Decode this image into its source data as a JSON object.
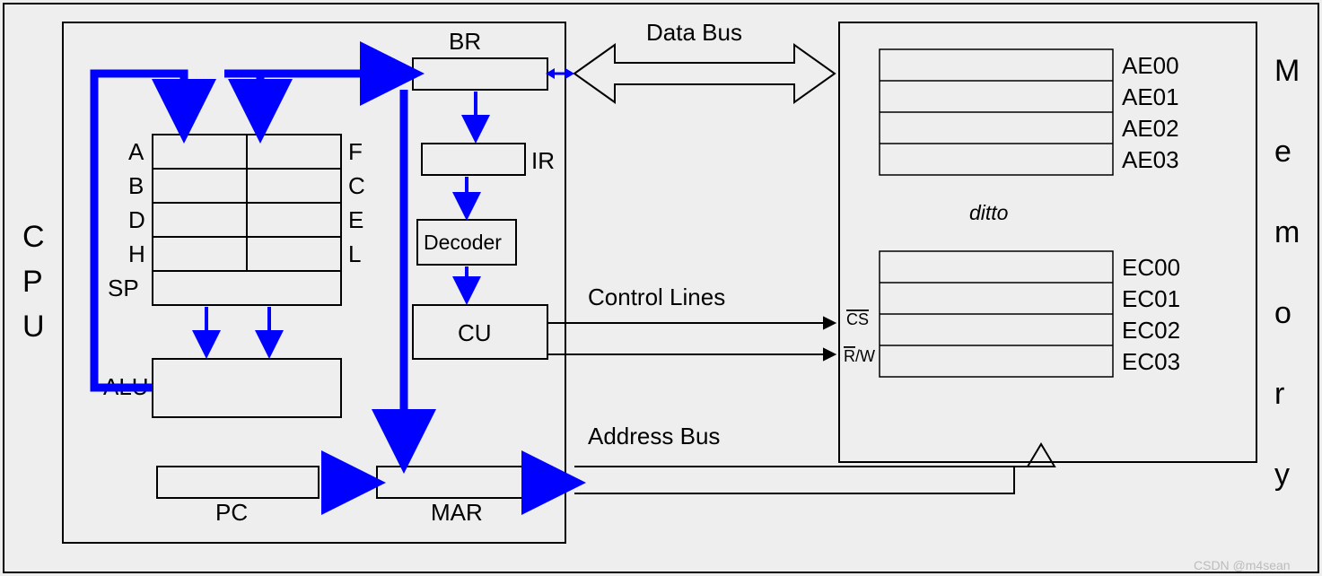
{
  "cpu": {
    "title_letters": [
      "C",
      "P",
      "U"
    ],
    "registers_left": [
      "A",
      "B",
      "D",
      "H",
      "SP"
    ],
    "registers_right": [
      "F",
      "C",
      "E",
      "L"
    ],
    "alu": "ALU",
    "pc": "PC",
    "mar": "MAR",
    "br": "BR",
    "ir": "IR",
    "decoder": "Decoder",
    "cu": "CU"
  },
  "buses": {
    "data": "Data Bus",
    "control": "Control Lines",
    "address": "Address Bus"
  },
  "memory": {
    "title_letters": [
      "M",
      "e",
      "m",
      "o",
      "r",
      "y"
    ],
    "cs": "CS",
    "rw": "R/W",
    "ditto": "ditto",
    "block1": [
      "AE00",
      "AE01",
      "AE02",
      "AE03"
    ],
    "block2": [
      "EC00",
      "EC01",
      "EC02",
      "EC03"
    ]
  },
  "watermark": "CSDN @m4sean"
}
